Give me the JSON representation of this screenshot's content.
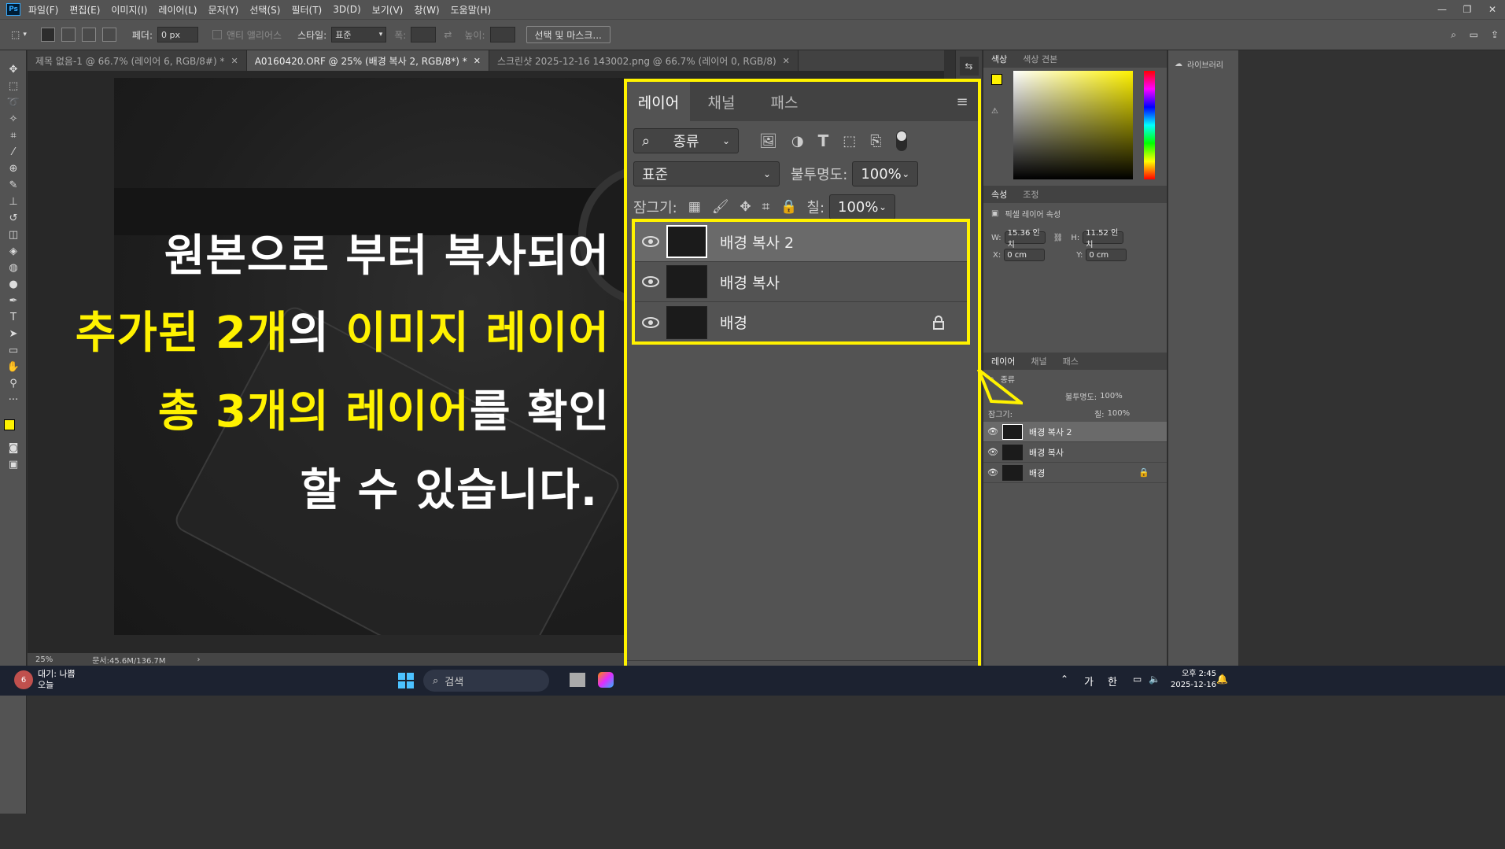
{
  "menubar": {
    "items": [
      "파일(F)",
      "편집(E)",
      "이미지(I)",
      "레이어(L)",
      "문자(Y)",
      "선택(S)",
      "필터(T)",
      "3D(D)",
      "보기(V)",
      "창(W)",
      "도움말(H)"
    ],
    "app_logo": "Ps"
  },
  "options": {
    "feather_label": "페더:",
    "feather_value": "0 px",
    "antialias_label": "앤티 앨리어스",
    "style_label": "스타일:",
    "style_value": "표준",
    "width_label": "폭:",
    "height_label": "높이:",
    "select_mask_button": "선택 및 마스크..."
  },
  "tabs": [
    {
      "label": "제목 없음-1 @ 66.7% (레이어 6, RGB/8#) *",
      "active": false
    },
    {
      "label": "A0160420.ORF @ 25% (배경 복사 2, RGB/8*) *",
      "active": true
    },
    {
      "label": "스크린샷 2025-12-16 143002.png @ 66.7% (레이어 0, RGB/8)",
      "active": false
    }
  ],
  "overlay": {
    "line1": "원본으로 부터 복사되어",
    "line2_yellow_a": "추가된 2개",
    "line2_white_a": "의 ",
    "line2_yellow_b": "이미지 레이어",
    "line3_yellow_a": "총 3개의 레이어",
    "line3_white_a": "를 확인",
    "line4": "할 수 있습니다."
  },
  "status": {
    "zoom": "25%",
    "doc": "문서:45.6M/136.7M"
  },
  "big_layers_panel": {
    "tabs": [
      "레이어",
      "채널",
      "패스"
    ],
    "filter_label": "종류",
    "blend_mode": "표준",
    "opacity_label": "불투명도:",
    "opacity_value": "100%",
    "lock_label": "잠그기:",
    "fill_label": "칠:",
    "fill_value": "100%",
    "layers": [
      {
        "name": "배경 복사 2",
        "selected": true,
        "locked": false
      },
      {
        "name": "배경 복사",
        "selected": false,
        "locked": false
      },
      {
        "name": "배경",
        "selected": false,
        "locked": true
      }
    ]
  },
  "color_panel": {
    "tabs": [
      "색상",
      "색상 견본"
    ],
    "foreground": "#fff200",
    "background": "#ffffff"
  },
  "properties_panel": {
    "tabs": [
      "속성",
      "조정"
    ],
    "title": "픽셀 레이어 속성",
    "w_label": "W:",
    "w_value": "15.36 인치",
    "h_label": "H:",
    "h_value": "11.52 인치",
    "x_label": "X:",
    "x_value": "0 cm",
    "y_label": "Y:",
    "y_value": "0 cm"
  },
  "small_layers_panel": {
    "tabs": [
      "레이어",
      "채널",
      "패스"
    ],
    "filter_label": "종류",
    "opacity_label": "불투명도:",
    "opacity_value": "100%",
    "lock_label": "잠그기:",
    "fill_label": "칠:",
    "fill_value": "100%",
    "layers": [
      "배경 복사 2",
      "배경 복사",
      "배경"
    ]
  },
  "library": {
    "label": "라이브러리"
  },
  "taskbar": {
    "weather_badge": "6",
    "weather_line1": "대기: 나쁨",
    "weather_line2": "오늘",
    "search_placeholder": "검색",
    "ime1": "가",
    "ime2": "한",
    "time": "오후 2:45",
    "date": "2025-12-16"
  },
  "colors": {
    "highlight": "#fff200",
    "panel_bg": "#535353",
    "selected_layer": "#6a6a6a"
  }
}
